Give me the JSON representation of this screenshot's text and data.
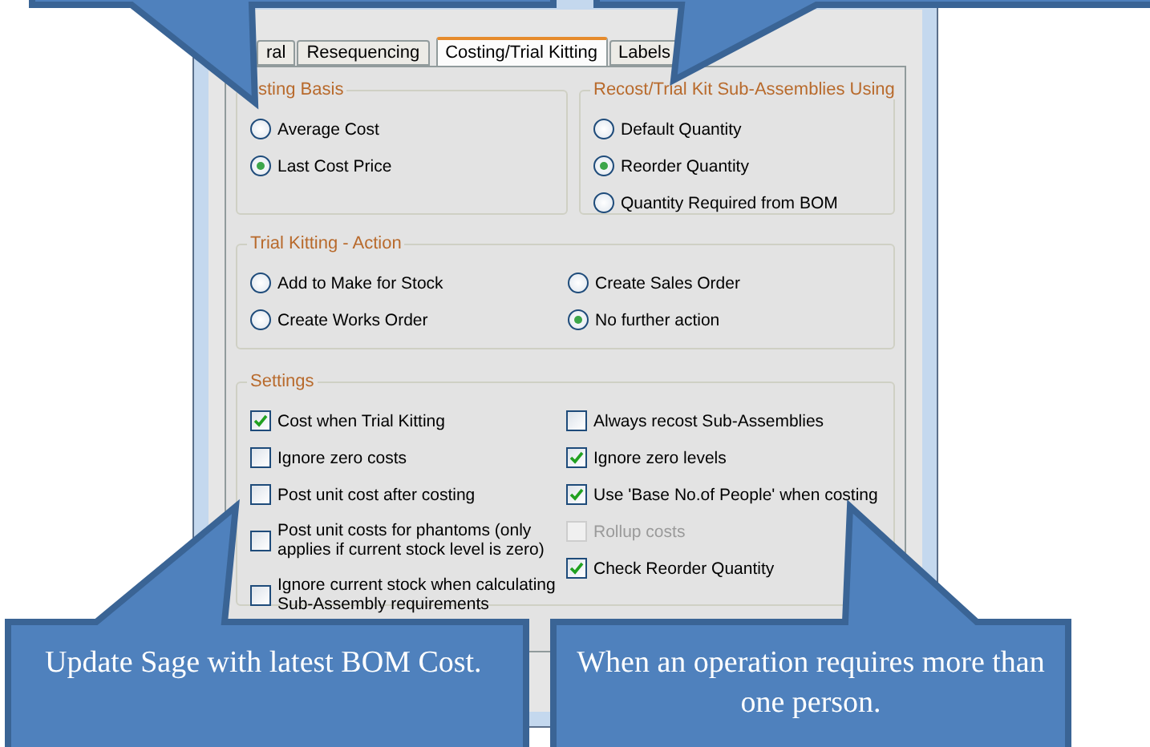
{
  "tabs": [
    {
      "label": "ral",
      "selected": false
    },
    {
      "label": "Resequencing",
      "selected": false
    },
    {
      "label": "Costing/Trial Kitting",
      "selected": true
    },
    {
      "label": "Labels",
      "selected": false
    }
  ],
  "costing_basis": {
    "legend": "sting Basis",
    "options": [
      {
        "label": "Average Cost",
        "selected": false
      },
      {
        "label": "Last Cost Price",
        "selected": true
      }
    ]
  },
  "recost_using": {
    "legend": "Recost/Trial Kit Sub-Assemblies Using",
    "options": [
      {
        "label": "Default Quantity",
        "selected": false
      },
      {
        "label": "Reorder Quantity",
        "selected": true
      },
      {
        "label": "Quantity Required from BOM",
        "selected": false
      }
    ]
  },
  "trial_kitting_action": {
    "legend": "Trial Kitting - Action",
    "options": [
      {
        "label": "Add to Make for Stock",
        "selected": false
      },
      {
        "label": "Create Sales Order",
        "selected": false
      },
      {
        "label": "Create Works Order",
        "selected": false
      },
      {
        "label": "No further action",
        "selected": true
      }
    ]
  },
  "settings": {
    "legend": "Settings",
    "left": [
      {
        "label": "Cost when Trial Kitting",
        "checked": true,
        "disabled": false
      },
      {
        "label": "Ignore zero costs",
        "checked": false,
        "disabled": false
      },
      {
        "label": "Post unit cost after costing",
        "checked": false,
        "disabled": false
      },
      {
        "label": "Post unit costs for phantoms (only applies if current stock level is zero)",
        "checked": false,
        "disabled": false
      },
      {
        "label": "Ignore current stock when calculating Sub-Assembly requirements",
        "checked": false,
        "disabled": false
      }
    ],
    "right": [
      {
        "label": "Always recost Sub-Assemblies",
        "checked": false,
        "disabled": false
      },
      {
        "label": "Ignore zero levels",
        "checked": true,
        "disabled": false
      },
      {
        "label": "Use 'Base No.of People' when costing",
        "checked": true,
        "disabled": false
      },
      {
        "label": "Rollup costs",
        "checked": false,
        "disabled": true
      },
      {
        "label": "Check Reorder Quantity",
        "checked": true,
        "disabled": false
      }
    ]
  },
  "callouts": [
    {
      "text": "Update Sage with latest BOM Cost."
    },
    {
      "text": "When an operation requires more than one person."
    }
  ]
}
